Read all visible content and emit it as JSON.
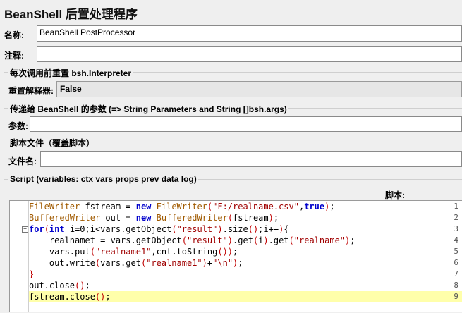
{
  "window": {
    "title": "BeanShell 后置处理程序"
  },
  "name": {
    "label": "名称:",
    "value": "BeanShell PostProcessor"
  },
  "comment": {
    "label": "注释:",
    "value": ""
  },
  "reset_group": {
    "legend": "每次调用前重置 bsh.Interpreter",
    "label": "重置解释器:",
    "value": "False"
  },
  "params_group": {
    "legend": "传递给 BeanShell 的参数 (=> String Parameters and String []bsh.args)",
    "label": "参数:",
    "value": ""
  },
  "file_group": {
    "legend": "脚本文件（覆盖脚本）",
    "label": "文件名:",
    "value": ""
  },
  "script_group": {
    "legend": "Script (variables: ctx vars props prev data log)",
    "label": "脚本:"
  },
  "code_lines": [
    {
      "n": "1",
      "parts": [
        [
          "t",
          "FileWriter"
        ],
        [
          "",
          " fstream = "
        ],
        [
          "k",
          "new"
        ],
        [
          "",
          " "
        ],
        [
          "t",
          "FileWriter"
        ],
        [
          "p",
          "("
        ],
        [
          "s",
          "\"F:/realname.csv\""
        ],
        [
          "",
          ","
        ],
        [
          "k",
          "true"
        ],
        [
          "p",
          ")"
        ],
        [
          "",
          ";"
        ]
      ]
    },
    {
      "n": "2",
      "parts": [
        [
          "t",
          "BufferedWriter"
        ],
        [
          "",
          " out = "
        ],
        [
          "k",
          "new"
        ],
        [
          "",
          " "
        ],
        [
          "t",
          "BufferedWriter"
        ],
        [
          "p",
          "("
        ],
        [
          "",
          "fstream"
        ],
        [
          "p",
          ")"
        ],
        [
          "",
          ";"
        ]
      ]
    },
    {
      "n": "3",
      "parts": [
        [
          "k",
          "for"
        ],
        [
          "p",
          "("
        ],
        [
          "k",
          "int"
        ],
        [
          "",
          " i=0;i<vars.getObject"
        ],
        [
          "p",
          "("
        ],
        [
          "s",
          "\"result\""
        ],
        [
          "p",
          ")"
        ],
        [
          "",
          ".size"
        ],
        [
          "p",
          "()"
        ],
        [
          "",
          ";i++"
        ],
        [
          "p",
          ")"
        ],
        [
          "",
          "{"
        ]
      ]
    },
    {
      "n": "4",
      "parts": [
        [
          "",
          "    realnamet = vars.getObject"
        ],
        [
          "p",
          "("
        ],
        [
          "s",
          "\"result\""
        ],
        [
          "p",
          ")"
        ],
        [
          "",
          ".get"
        ],
        [
          "p",
          "("
        ],
        [
          "",
          "i"
        ],
        [
          "p",
          ")"
        ],
        [
          "",
          ".get"
        ],
        [
          "p",
          "("
        ],
        [
          "s",
          "\"realname\""
        ],
        [
          "p",
          ")"
        ],
        [
          "",
          ";"
        ]
      ]
    },
    {
      "n": "5",
      "parts": [
        [
          "",
          "    vars.put"
        ],
        [
          "p",
          "("
        ],
        [
          "s",
          "\"realname1\""
        ],
        [
          "",
          ",cnt.toString"
        ],
        [
          "p",
          "())"
        ],
        [
          "",
          ";"
        ]
      ]
    },
    {
      "n": "6",
      "parts": [
        [
          "",
          "    out.write"
        ],
        [
          "p",
          "("
        ],
        [
          "",
          "vars.get"
        ],
        [
          "p",
          "("
        ],
        [
          "s",
          "\"realname1\""
        ],
        [
          "p",
          ")"
        ],
        [
          "",
          "+"
        ],
        [
          "s",
          "\"\\n\""
        ],
        [
          "p",
          ")"
        ],
        [
          "",
          ";"
        ]
      ]
    },
    {
      "n": "7",
      "parts": [
        [
          "p",
          "}"
        ]
      ]
    },
    {
      "n": "8",
      "parts": [
        [
          "",
          "out.close"
        ],
        [
          "p",
          "()"
        ],
        [
          "",
          ";"
        ]
      ]
    },
    {
      "n": "9",
      "parts": [
        [
          "",
          "fstream.close"
        ],
        [
          "p",
          "()"
        ],
        [
          "",
          ";"
        ]
      ]
    }
  ]
}
